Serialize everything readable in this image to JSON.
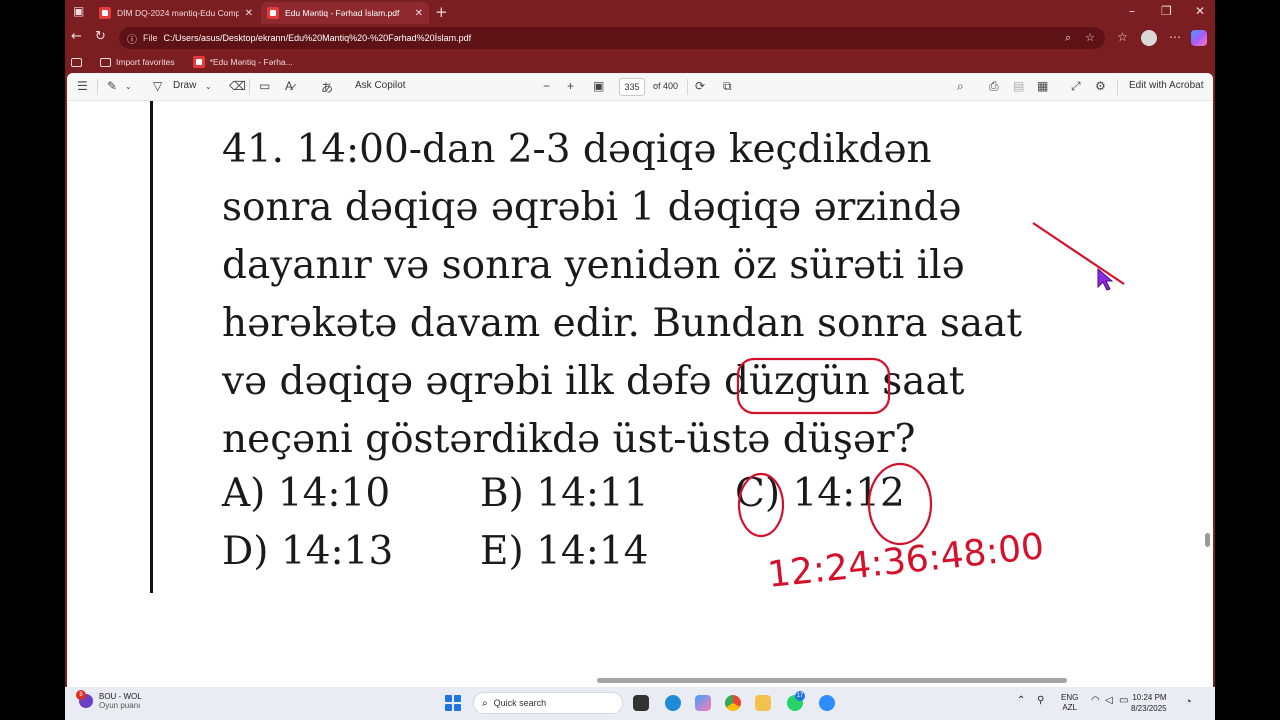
{
  "browser": {
    "tabs": [
      {
        "title": "DİM DQ-2024 məntiq-Edu Comp"
      },
      {
        "title": "Edu Məntiq - Fərhad İslam.pdf"
      }
    ],
    "address": {
      "prefix": "File",
      "url": "C:/Users/asus/Desktop/ekrann/Edu%20Mantiq%20-%20Fərhad%20İslam.pdf"
    },
    "favorites": [
      {
        "label": "Import favorites"
      },
      {
        "label": "*Edu Məntiq - Fərha..."
      }
    ]
  },
  "pdf_toolbar": {
    "draw_label": "Draw",
    "ask_copilot": "Ask Copilot",
    "current_page": "335",
    "page_total": "of 400",
    "edit_acrobat": "Edit with Acrobat"
  },
  "question": {
    "lines": [
      "41. 14:00-dan 2-3 dəqiqə keçdikdən",
      "sonra dəqiqə əqrəbi 1 dəqiqə ərzində",
      "dayanır və sonra yenidən öz sürəti ilə",
      "hərəkətə davam edir. Bundan sonra saat",
      "və dəqiqə əqrəbi ilk dəfə düzgün saat",
      "neçəni göstərdikdə üst-üstə düşər?"
    ],
    "options": [
      {
        "label": "A) 14:10"
      },
      {
        "label": "B) 14:11"
      },
      {
        "label": "C) 14:12"
      },
      {
        "label": "D) 14:13"
      },
      {
        "label": "E) 14:14"
      }
    ],
    "handwritten_note": "12:24:36:48:00"
  },
  "annotation_color": "#d4102a",
  "taskbar": {
    "weather_title": "BOU - WOL",
    "weather_sub": "Oyun puanı",
    "weather_badge": "8",
    "search_placeholder": "Quick search",
    "whatsapp_badge": "17",
    "lang_1": "ENG",
    "lang_2": "AZL",
    "time": "10:24 PM",
    "date": "8/23/2025"
  }
}
